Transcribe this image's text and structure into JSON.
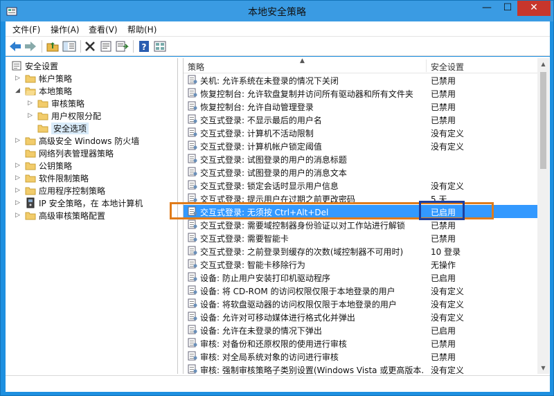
{
  "window": {
    "title": "本地安全策略",
    "minimize": "—",
    "maximize": "☐",
    "close": "✕"
  },
  "menu": [
    "文件(F)",
    "操作(A)",
    "查看(V)",
    "帮助(H)"
  ],
  "tree": [
    {
      "label": "安全设置",
      "icon": "security-settings-icon",
      "arrow": ""
    },
    {
      "label": "帐户策略",
      "icon": "folder-icon",
      "arrow": "▷"
    },
    {
      "label": "本地策略",
      "icon": "folder-open-icon",
      "arrow": "◢"
    },
    {
      "label": "审核策略",
      "icon": "folder-icon",
      "arrow": "▷"
    },
    {
      "label": "用户权限分配",
      "icon": "folder-icon",
      "arrow": "▷"
    },
    {
      "label": "安全选项",
      "icon": "folder-icon",
      "arrow": "",
      "selected": true
    },
    {
      "label": "高级安全 Windows 防火墙",
      "icon": "folder-icon",
      "arrow": "▷"
    },
    {
      "label": "网络列表管理器策略",
      "icon": "folder-icon",
      "arrow": ""
    },
    {
      "label": "公钥策略",
      "icon": "folder-icon",
      "arrow": "▷"
    },
    {
      "label": "软件限制策略",
      "icon": "folder-icon",
      "arrow": "▷"
    },
    {
      "label": "应用程序控制策略",
      "icon": "folder-icon",
      "arrow": "▷"
    },
    {
      "label": "IP 安全策略，在 本地计算机",
      "icon": "ip-security-icon",
      "arrow": "▷"
    },
    {
      "label": "高级审核策略配置",
      "icon": "folder-icon",
      "arrow": "▷"
    }
  ],
  "list": {
    "columns": [
      "策略",
      "安全设置"
    ],
    "rows": [
      {
        "policy": "关机: 允许系统在未登录的情况下关闭",
        "setting": "已禁用"
      },
      {
        "policy": "恢复控制台: 允许软盘复制并访问所有驱动器和所有文件夹",
        "setting": "已禁用"
      },
      {
        "policy": "恢复控制台: 允许自动管理登录",
        "setting": "已禁用"
      },
      {
        "policy": "交互式登录: 不显示最后的用户名",
        "setting": "已禁用"
      },
      {
        "policy": "交互式登录: 计算机不活动限制",
        "setting": "没有定义"
      },
      {
        "policy": "交互式登录: 计算机帐户锁定阈值",
        "setting": "没有定义"
      },
      {
        "policy": "交互式登录: 试图登录的用户的消息标题",
        "setting": ""
      },
      {
        "policy": "交互式登录: 试图登录的用户的消息文本",
        "setting": ""
      },
      {
        "policy": "交互式登录: 锁定会话时显示用户信息",
        "setting": "没有定义"
      },
      {
        "policy": "交互式登录: 提示用户在过期之前更改密码",
        "setting": "5 天"
      },
      {
        "policy": "交互式登录: 无须按 Ctrl+Alt+Del",
        "setting": "已启用",
        "selected": true
      },
      {
        "policy": "交互式登录: 需要域控制器身份验证以对工作站进行解锁",
        "setting": "已禁用"
      },
      {
        "policy": "交互式登录: 需要智能卡",
        "setting": "已禁用"
      },
      {
        "policy": "交互式登录: 之前登录到缓存的次数(域控制器不可用时)",
        "setting": "10 登录"
      },
      {
        "policy": "交互式登录: 智能卡移除行为",
        "setting": "无操作"
      },
      {
        "policy": "设备: 防止用户安装打印机驱动程序",
        "setting": "已启用"
      },
      {
        "policy": "设备: 将 CD-ROM 的访问权限仅限于本地登录的用户",
        "setting": "没有定义"
      },
      {
        "policy": "设备: 将软盘驱动器的访问权限仅限于本地登录的用户",
        "setting": "没有定义"
      },
      {
        "policy": "设备: 允许对可移动媒体进行格式化并弹出",
        "setting": "没有定义"
      },
      {
        "policy": "设备: 允许在未登录的情况下弹出",
        "setting": "已启用"
      },
      {
        "policy": "审核: 对备份和还原权限的使用进行审核",
        "setting": "已禁用"
      },
      {
        "policy": "审核: 对全局系统对象的访问进行审核",
        "setting": "已禁用"
      },
      {
        "policy": "审核: 强制审核策略子类别设置(Windows Vista 或更高版本...",
        "setting": "没有定义"
      }
    ]
  },
  "colors": {
    "selection": "#3399ff",
    "highlight_orange": "#e07b1a",
    "highlight_blue": "#1d3f9e",
    "titlebar": "#3a9be3"
  }
}
